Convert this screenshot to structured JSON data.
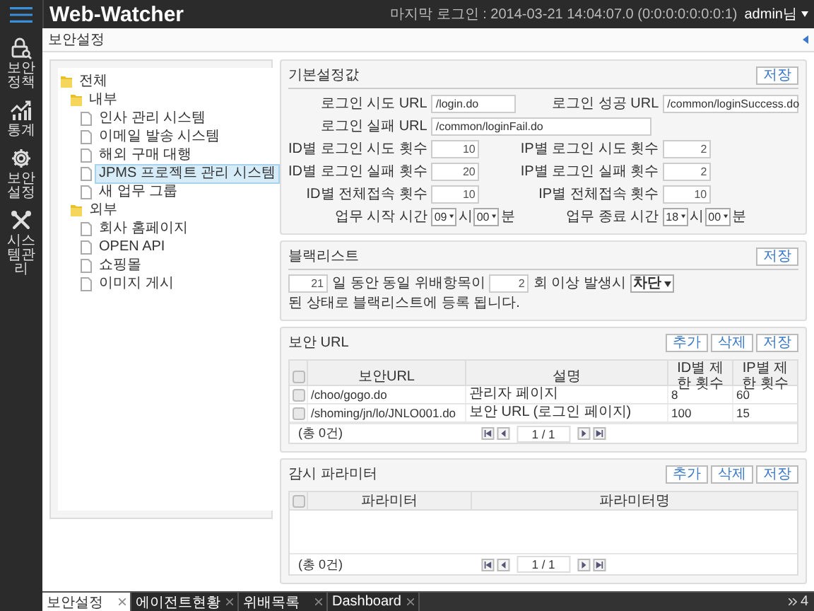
{
  "app": {
    "title": "Web-Watcher",
    "last_login": "마지막 로그인 : 2014-03-21 14:04:07.0 (0:0:0:0:0:0:0:1)",
    "user": "admin님"
  },
  "sidebar": {
    "items": [
      {
        "label": "보안정책",
        "kind": "policy"
      },
      {
        "label": "통계",
        "kind": "stats"
      },
      {
        "label": "보안설정",
        "kind": "settings"
      },
      {
        "label": "시스템관리",
        "kind": "system"
      }
    ]
  },
  "page_title": "보안설정",
  "tree": [
    {
      "label": "전체",
      "selected": false,
      "children": [
        {
          "label": "내부",
          "selected": false,
          "children": [
            {
              "label": "인사 관리 시스템",
              "selected": false
            },
            {
              "label": "이메일 발송 시스템",
              "selected": false
            },
            {
              "label": "해외 구매 대행",
              "selected": false
            },
            {
              "label": "JPMS 프로젝트 관리 시스템",
              "selected": true
            },
            {
              "label": "새 업무 그룹",
              "selected": false
            }
          ]
        },
        {
          "label": "외부",
          "selected": false,
          "children": [
            {
              "label": "회사 홈페이지",
              "selected": false
            },
            {
              "label": "OPEN API",
              "selected": false
            },
            {
              "label": "쇼핑몰",
              "selected": false
            },
            {
              "label": "이미지 게시",
              "selected": false
            }
          ]
        }
      ]
    }
  ],
  "basic_settings": {
    "title": "기본설정값",
    "save": "저장",
    "rows": [
      [
        {
          "label": "로그인 시도 URL",
          "kind": "url",
          "value": "/login.do"
        },
        {
          "label": "로그인 성공 URL",
          "kind": "url",
          "value": "/common/loginSuccess.do"
        }
      ],
      [
        {
          "label": "로그인 실패 URL",
          "kind": "url",
          "value": "/common/loginFail.do"
        }
      ],
      [
        {
          "label": "ID별 로그인 시도 횟수",
          "kind": "number",
          "value": "10"
        },
        {
          "label": "IP별 로그인 시도 횟수",
          "kind": "number",
          "value": "2"
        }
      ],
      [
        {
          "label": "ID별 로그인 실패 횟수",
          "kind": "number",
          "value": "20"
        },
        {
          "label": "IP별 로그인 실패 횟수",
          "kind": "number",
          "value": "2"
        }
      ],
      [
        {
          "label": "ID별 전체접속 횟수",
          "kind": "number",
          "value": "10"
        },
        {
          "label": "IP별 전체접속 횟수",
          "kind": "number",
          "value": "10"
        }
      ],
      [
        {
          "label": "업무 시작 시간",
          "kind": "time",
          "hour": "09",
          "hour_unit": "시",
          "minute": "00",
          "minute_unit": "분"
        },
        {
          "label": "업무 종료 시간",
          "kind": "time",
          "hour": "18",
          "hour_unit": "시",
          "minute": "00",
          "minute_unit": "분"
        }
      ]
    ]
  },
  "blacklist": {
    "title": "블랙리스트",
    "save": "저장",
    "days": "21",
    "text_1": "일 동안 동일 위배항목이",
    "count": "2",
    "text_2": "회 이상 발생시",
    "action": "차단",
    "text_3": "된 상태로 블랙리스트에 등록 됩니다."
  },
  "tables": [
    {
      "title": "보안 URL",
      "buttons": [
        "추가",
        "삭제",
        "저장"
      ],
      "all_checked": false,
      "columns": [
        "보안URL",
        "설명",
        "ID별 제한 횟수",
        "IP별 제한 횟수"
      ],
      "rows": [
        {
          "checked": false,
          "cells": [
            "/choo/gogo.do",
            "관리자 페이지",
            "8",
            "60"
          ]
        },
        {
          "checked": false,
          "cells": [
            "/shoming/jn/lo/JNLO001.do",
            "보안 URL (로그인 페이지)",
            "100",
            "15"
          ]
        }
      ],
      "total": "(총 0건)",
      "page": "1 / 1"
    },
    {
      "title": "감시 파라미터",
      "buttons": [
        "추가",
        "삭제",
        "저장"
      ],
      "all_checked": false,
      "columns": [
        "파라미터",
        "파라미터명"
      ],
      "total": "(총 0건)",
      "page": "1 / 1"
    }
  ],
  "bottom_tabs": [
    {
      "label": "보안설정",
      "selected": true
    },
    {
      "label": "에이전트현황",
      "selected": false
    },
    {
      "label": "위배목록",
      "selected": false
    },
    {
      "label": "Dashboard",
      "selected": false
    }
  ],
  "tab_count": "4"
}
